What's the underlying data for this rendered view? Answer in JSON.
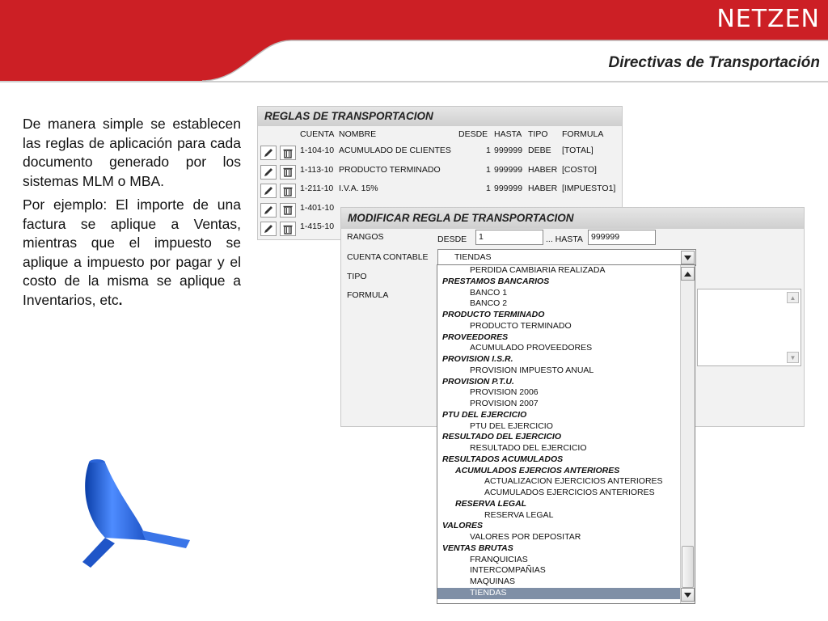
{
  "header": {
    "brand": "NETZEN",
    "subtitle": "Directivas de Transportación"
  },
  "colors": {
    "brand_red": "#cc1f25",
    "selected_bg": "#7f8fa6"
  },
  "intro": {
    "p1": "De manera simple se establecen las reglas de aplicación para cada documento generado por los sistemas MLM o MBA.",
    "p2": "Por ejemplo: El importe de una factura se aplique a Ventas, mientras que el impuesto se aplique a impuesto por pagar y el costo de la misma se aplique a Inventarios, etc",
    "p2_end": "."
  },
  "rules_panel": {
    "title": "REGLAS DE TRANSPORTACION",
    "columns": [
      "CUENTA",
      "NOMBRE",
      "DESDE",
      "HASTA",
      "TIPO",
      "FORMULA"
    ],
    "rows": [
      {
        "cuenta": "1-104-10",
        "nombre": "ACUMULADO DE CLIENTES",
        "desde": "1",
        "hasta": "999999",
        "tipo": "DEBE",
        "formula": "[TOTAL]"
      },
      {
        "cuenta": "1-113-10",
        "nombre": "PRODUCTO TERMINADO",
        "desde": "1",
        "hasta": "999999",
        "tipo": "HABER",
        "formula": "[COSTO]"
      },
      {
        "cuenta": "1-211-10",
        "nombre": "I.V.A. 15%",
        "desde": "1",
        "hasta": "999999",
        "tipo": "HABER",
        "formula": "[IMPUESTO1]"
      },
      {
        "cuenta": "1-401-10",
        "nombre": "",
        "desde": "",
        "hasta": "",
        "tipo": "",
        "formula": ""
      },
      {
        "cuenta": "1-415-10",
        "nombre": "",
        "desde": "",
        "hasta": "",
        "tipo": "",
        "formula": ""
      }
    ],
    "edit_icon": "pencil-icon",
    "delete_icon": "trash-icon"
  },
  "modify_panel": {
    "title": "MODIFICAR REGLA DE TRANSPORTACION",
    "rangos_label": "RANGOS",
    "desde_label": "DESDE",
    "desde_value": "1",
    "hasta_label": "... HASTA",
    "hasta_value": "999999",
    "cuenta_label": "CUENTA CONTABLE",
    "cuenta_value": "TIENDAS",
    "tipo_label": "TIPO",
    "formula_label": "FORMULA"
  },
  "dropdown": {
    "items": [
      {
        "text": "PERDIDA CAMBIARIA REALIZADA",
        "level": 2,
        "group": false
      },
      {
        "text": "PRESTAMOS BANCARIOS",
        "level": 0,
        "group": true
      },
      {
        "text": "BANCO 1",
        "level": 2,
        "group": false
      },
      {
        "text": "BANCO 2",
        "level": 2,
        "group": false
      },
      {
        "text": "PRODUCTO TERMINADO",
        "level": 0,
        "group": true
      },
      {
        "text": "PRODUCTO TERMINADO",
        "level": 2,
        "group": false
      },
      {
        "text": "PROVEEDORES",
        "level": 0,
        "group": true
      },
      {
        "text": "ACUMULADO PROVEEDORES",
        "level": 2,
        "group": false
      },
      {
        "text": "PROVISION I.S.R.",
        "level": 0,
        "group": true
      },
      {
        "text": "PROVISION IMPUESTO ANUAL",
        "level": 2,
        "group": false
      },
      {
        "text": "PROVISION P.T.U.",
        "level": 0,
        "group": true
      },
      {
        "text": "PROVISION 2006",
        "level": 2,
        "group": false
      },
      {
        "text": "PROVISION 2007",
        "level": 2,
        "group": false
      },
      {
        "text": "PTU DEL EJERCICIO",
        "level": 0,
        "group": true
      },
      {
        "text": "PTU DEL EJERCICIO",
        "level": 2,
        "group": false
      },
      {
        "text": "RESULTADO DEL EJERCICIO",
        "level": 0,
        "group": true
      },
      {
        "text": "RESULTADO DEL EJERCICIO",
        "level": 2,
        "group": false
      },
      {
        "text": "RESULTADOS ACUMULADOS",
        "level": 0,
        "group": true
      },
      {
        "text": "ACUMULADOS EJERCIOS ANTERIORES",
        "level": 1,
        "group": true
      },
      {
        "text": "ACTUALIZACION EJERCICIOS ANTERIORES",
        "level": 3,
        "group": false
      },
      {
        "text": "ACUMULADOS EJERCICIOS ANTERIORES",
        "level": 3,
        "group": false
      },
      {
        "text": "RESERVA LEGAL",
        "level": 1,
        "group": true
      },
      {
        "text": "RESERVA LEGAL",
        "level": 3,
        "group": false
      },
      {
        "text": "VALORES",
        "level": 0,
        "group": true
      },
      {
        "text": "VALORES POR DEPOSITAR",
        "level": 2,
        "group": false
      },
      {
        "text": "VENTAS BRUTAS",
        "level": 0,
        "group": true
      },
      {
        "text": "FRANQUICIAS",
        "level": 2,
        "group": false
      },
      {
        "text": "INTERCOMPAÑIAS",
        "level": 2,
        "group": false
      },
      {
        "text": "MAQUINAS",
        "level": 2,
        "group": false
      },
      {
        "text": "TIENDAS",
        "level": 2,
        "group": false,
        "selected": true
      }
    ]
  }
}
